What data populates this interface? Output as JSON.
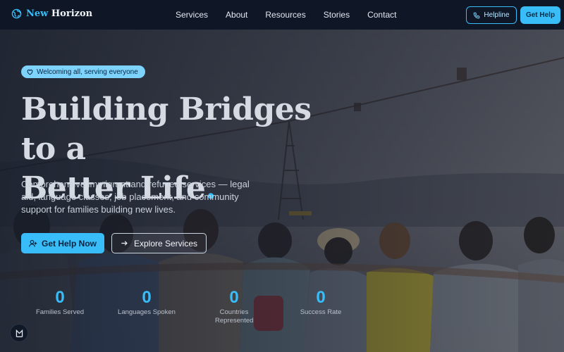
{
  "header": {
    "brand_word1": "New",
    "brand_word2": "Horizon",
    "nav": [
      "Services",
      "About",
      "Resources",
      "Stories",
      "Contact"
    ],
    "helpline_label": "Helpline",
    "get_help_label": "Get Help"
  },
  "hero": {
    "badge": "Welcoming all, serving everyone",
    "headline_line1": "Building Bridges to a",
    "headline_line2": "Better Life",
    "headline_dot": ".",
    "subtext": "Comprehensive immigrant and refugee services — legal aid, language classes, job placement, and community support for families building new lives.",
    "cta_primary": "Get Help Now",
    "cta_secondary": "Explore Services"
  },
  "stats": [
    {
      "value": "0",
      "label": "Families Served"
    },
    {
      "value": "0",
      "label": "Languages Spoken"
    },
    {
      "value": "0",
      "label": "Countries Represented"
    },
    {
      "value": "0",
      "label": "Success Rate"
    }
  ],
  "colors": {
    "accent": "#38bdf8",
    "nav_bg": "#0f1626",
    "headline": "#d6dae2"
  },
  "icons": {
    "brand": "globe-icon",
    "badge": "heart-icon",
    "helpline": "phone-icon",
    "cta_primary": "user-plus-icon",
    "cta_secondary": "arrow-right-icon",
    "corner": "accessibility-icon"
  }
}
